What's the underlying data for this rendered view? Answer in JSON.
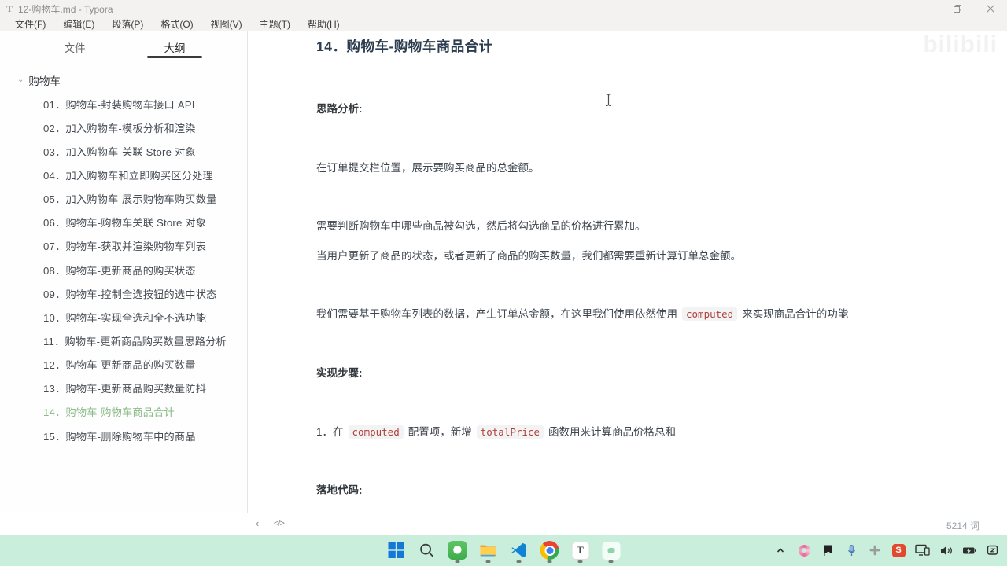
{
  "window": {
    "title": "12-购物车.md - Typora",
    "logo_glyph": "T"
  },
  "menu": {
    "items": [
      "文件(F)",
      "编辑(E)",
      "段落(P)",
      "格式(O)",
      "视图(V)",
      "主题(T)",
      "帮助(H)"
    ]
  },
  "sidebar": {
    "tabs": {
      "files": "文件",
      "outline": "大纲"
    },
    "root_label": "购物车",
    "items": [
      {
        "label": "01．购物车-封装购物车接口 API"
      },
      {
        "label": "02．加入购物车-模板分析和渲染"
      },
      {
        "label": "03．加入购物车-关联 Store 对象"
      },
      {
        "label": "04．加入购物车和立即购买区分处理"
      },
      {
        "label": "05．加入购物车-展示购物车购买数量"
      },
      {
        "label": "06．购物车-购物车关联 Store 对象"
      },
      {
        "label": "07．购物车-获取并渲染购物车列表"
      },
      {
        "label": "08．购物车-更新商品的购买状态"
      },
      {
        "label": "09．购物车-控制全选按钮的选中状态"
      },
      {
        "label": "10．购物车-实现全选和全不选功能"
      },
      {
        "label": "11．购物车-更新商品购买数量思路分析"
      },
      {
        "label": "12．购物车-更新商品的购买数量"
      },
      {
        "label": "13．购物车-更新商品购买数量防抖"
      },
      {
        "label": "14．购物车-购物车商品合计",
        "active": true
      },
      {
        "label": "15．购物车-删除购物车中的商品"
      }
    ]
  },
  "content": {
    "heading": "14．购物车-购物车商品合计",
    "analysis_label": "思路分析:",
    "p1": "在订单提交栏位置，展示要购买商品的总金额。",
    "p2": "需要判断购物车中哪些商品被勾选，然后将勾选商品的价格进行累加。",
    "p3": "当用户更新了商品的状态，或者更新了商品的购买数量，我们都需要重新计算订单总金额。",
    "p4_before": "我们需要基于购物车列表的数据，产生订单总金额，在这里我们使用依然使用",
    "p4_code": "computed",
    "p4_after": "来实现商品合计的功能",
    "steps_label": "实现步骤:",
    "li1_before": "1．在",
    "li1_code1": "computed",
    "li1_mid": "配置项，新增",
    "li1_code2": "totalPrice",
    "li1_after": "函数用来计算商品价格总和",
    "code_label": "落地代码:"
  },
  "footer": {
    "back_icon": "‹",
    "source_icon": "</>",
    "word_count": "5214 词"
  },
  "watermark": "bilibili",
  "taskbar": {
    "icons": [
      "windows-start",
      "search",
      "green-pet-app",
      "file-explorer",
      "vscode",
      "chrome",
      "typora",
      "unknown-app"
    ],
    "typora_glyph": "T"
  },
  "tray": {
    "icons": [
      "chevron-up",
      "pink-swirl",
      "flag",
      "microphone",
      "cross",
      "sogou-input",
      "connected-devices",
      "volume",
      "battery",
      "notification"
    ],
    "sogou_glyph": "S"
  },
  "colors": {
    "outline_active": "#89ba86",
    "inline_code_text": "#ae413c",
    "heading_text": "#2c3d4f",
    "taskbar_bg": "#c9efdc"
  }
}
